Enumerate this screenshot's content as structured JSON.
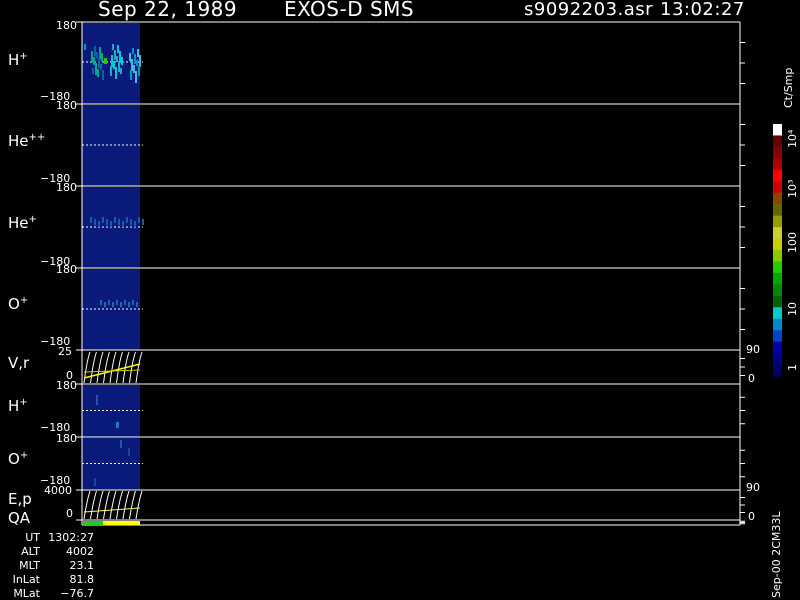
{
  "header": {
    "date": "Sep 22, 1989",
    "instrument": "EXOS-D SMS",
    "filename": "s9092203.asr",
    "time": "13:02:27"
  },
  "chart_data": {
    "type": "heatmap",
    "panels": [
      {
        "name": "H",
        "charge": "+",
        "ytop": "180",
        "ybot": "−180"
      },
      {
        "name": "He",
        "charge": "++",
        "ytop": "180",
        "ybot": "−180"
      },
      {
        "name": "He",
        "charge": "+",
        "ytop": "180",
        "ybot": "−180"
      },
      {
        "name": "O",
        "charge": "+",
        "ytop": "180",
        "ybot": "−180"
      },
      {
        "name": "V,r",
        "charge": "",
        "ytop": "25",
        "ybot": "0",
        "right_top": "90",
        "right_bot": "0"
      },
      {
        "name": "H",
        "charge": "+",
        "ytop": "180",
        "ybot": "−180"
      },
      {
        "name": "O",
        "charge": "+",
        "ytop": "180",
        "ybot": "−180"
      },
      {
        "name": "E,p",
        "charge": "",
        "ytop": "4000",
        "ybot": "0",
        "right_top": "90",
        "right_bot": "0"
      },
      {
        "name": "QA",
        "charge": "",
        "ytop": "",
        "ybot": ""
      }
    ],
    "colorbar": {
      "unit": "Ct/Smp",
      "labels": [
        "1",
        "10",
        "100",
        "10³",
        "10⁴"
      ],
      "colors": [
        "#000066",
        "#000088",
        "#0000aa",
        "#0044cc",
        "#0088cc",
        "#00cccc",
        "#006600",
        "#008800",
        "#00aa00",
        "#22cc00",
        "#88cc00",
        "#cccc00",
        "#cccc33",
        "#999900",
        "#666600",
        "#884400",
        "#cc0000",
        "#ff0000",
        "#aa0000",
        "#880000",
        "#660000",
        "#ffffff"
      ]
    }
  },
  "info": [
    {
      "key": "UT",
      "value": "1302:27"
    },
    {
      "key": "ALT",
      "value": "4002"
    },
    {
      "key": "MLT",
      "value": "23.1"
    },
    {
      "key": "InLat",
      "value": "81.8"
    },
    {
      "key": "MLat",
      "value": "−76.7"
    }
  ],
  "footer": {
    "tag": "Sep-00 2CM33L"
  }
}
